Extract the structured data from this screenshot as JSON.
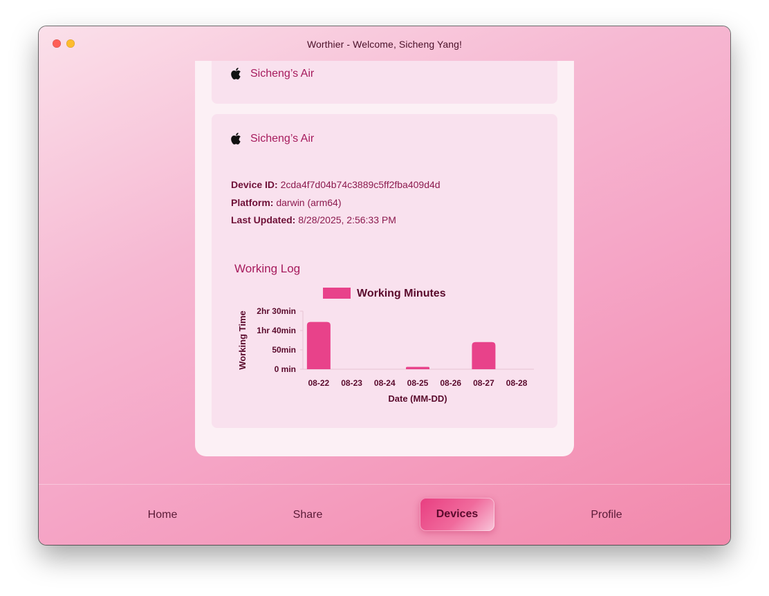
{
  "window": {
    "title": "Worthier - Welcome, Sicheng Yang!"
  },
  "devices": [
    {
      "name": "Sicheng’s Air",
      "icon": "apple-icon"
    },
    {
      "name": "Sicheng’s Air",
      "icon": "apple-icon",
      "device_id_label": "Device ID:",
      "device_id": "2cda4f7d04b74c3889c5ff2fba409d4d",
      "platform_label": "Platform:",
      "platform": "darwin (arm64)",
      "last_updated_label": "Last Updated:",
      "last_updated": "8/28/2025, 2:56:33 PM",
      "log_title": "Working Log"
    }
  ],
  "chart_data": {
    "type": "bar",
    "categories": [
      "08-22",
      "08-23",
      "08-24",
      "08-25",
      "08-26",
      "08-27",
      "08-28"
    ],
    "series": [
      {
        "name": "Working Minutes",
        "values": [
          122,
          0,
          0,
          6,
          0,
          70,
          0
        ],
        "color": "#e8428a"
      }
    ],
    "xlabel": "Date (MM-DD)",
    "ylabel": "Working Time",
    "ylim": [
      0,
      150
    ],
    "yticks": [
      {
        "value": 0,
        "label": "0 min"
      },
      {
        "value": 50,
        "label": "50min"
      },
      {
        "value": 100,
        "label": "1hr 40min"
      },
      {
        "value": 150,
        "label": "2hr 30min"
      }
    ],
    "legend": "top-center",
    "grid": false
  },
  "tabs": {
    "home": "Home",
    "share": "Share",
    "devices": "Devices",
    "profile": "Profile",
    "active": "devices"
  },
  "colors": {
    "accent": "#e8428a",
    "text_accent": "#a61a5c"
  }
}
